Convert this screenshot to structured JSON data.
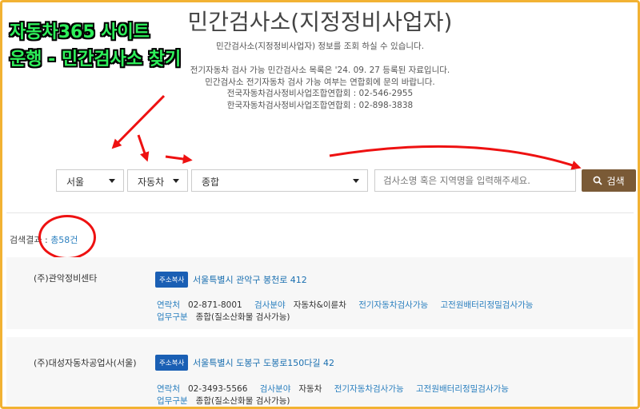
{
  "overlay": {
    "line1": "자동차365 사이트",
    "line2": "운행 - 민간검사소 찾기"
  },
  "page": {
    "title": "민간검사소(지정정비사업자)",
    "info1": "민간검사소(지정정비사업자) 정보를 조회 하실 수 있습니다.",
    "info2": "전기자동차 검사 가능 민간검사소 목록은 '24. 09. 27 등록된 자료입니다.",
    "info3": "민간검사소 전기자동차 검사 가능 여부는 연합회에 문의 바랍니다.",
    "info4": "전국자동차검사정비사업조합연합회 : 02-546-2955",
    "info5": "한국자동차검사정비사업조합연합회 : 02-898-3838"
  },
  "filters": {
    "region": "서울",
    "vehicle_type": "자동차",
    "category": "종합",
    "search_placeholder": "검사소명 혹은 지역명을 입력해주세요.",
    "search_button": "검색"
  },
  "results": {
    "label": "검색결과 : ",
    "count": "총58건"
  },
  "cards": [
    {
      "name": "(주)관악정비센타",
      "copy_label": "주소복사",
      "address": "서울특별시 관악구 봉천로 412",
      "contact_label": "연락처",
      "contact": "02-871-8001",
      "field_label": "검사분야",
      "field": "자동차&이륜차",
      "ev": "전기자동차검사가능",
      "hv": "고전원배터리정밀검사가능",
      "work_label": "업무구분",
      "work": "종합(질소산화물 검사가능)"
    },
    {
      "name": "(주)대성자동차공업사(서울)",
      "copy_label": "주소복사",
      "address": "서울특별시 도봉구 도봉로150다길 42",
      "contact_label": "연락처",
      "contact": "02-3493-5566",
      "field_label": "검사분야",
      "field": "자동차",
      "ev": "전기자동차검사가능",
      "hv": "고전원배터리정밀검사가능",
      "work_label": "업무구분",
      "work": "종합(질소산화물 검사가능)"
    }
  ],
  "colors": {
    "accent_button": "#7a5a36",
    "copy_button": "#1a5fb4",
    "link_blue": "#2a7fbf",
    "annotation_red": "#e11111",
    "overlay_green": "#2ef05a",
    "frame": "#f2b233"
  }
}
